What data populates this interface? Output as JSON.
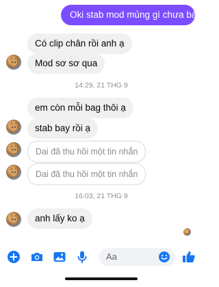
{
  "messages": {
    "out_1": "Oki stab mod mủng gì chưa bác",
    "in_1": "Có clip chân rồi anh ạ",
    "in_2": "Mod sơ sơ qua",
    "time_1": "14:29, 21 THG 9",
    "in_3": "em còn mỗi bag thôi ạ",
    "in_4": "stab bay rồi ạ",
    "unsent_1": "Dai đã thu hồi một tin nhắn",
    "unsent_2": "Dai đã thu hồi một tin nhắn",
    "time_2": "16:03, 21 THG 9",
    "in_5": "anh lấy ko ạ"
  },
  "composer": {
    "placeholder": "Aa",
    "icons": [
      "plus-icon",
      "camera-icon",
      "image-icon",
      "microphone-icon",
      "emoji-icon",
      "like-icon"
    ]
  },
  "colors": {
    "accent": "#1877f2",
    "outgoing_bubble": "#7b4dff",
    "incoming_bubble": "#f0f0f0"
  }
}
